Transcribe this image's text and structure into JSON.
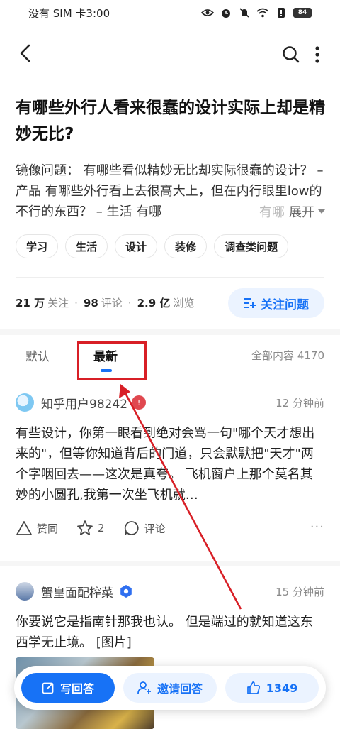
{
  "status_bar": {
    "carrier_time": "没有 SIM 卡3:00",
    "battery": "84"
  },
  "question": {
    "title": "有哪些外行人看来很蠢的设计实际上却是精妙无比?",
    "description": "镜像问题：  有哪些看似精妙无比却实际很蠢的设计？ – 产品  有哪些外行看上去很高大上，但在内行眼里low的不行的东西？ – 生活  有哪",
    "expand_fade": "有哪",
    "expand_label": "展开",
    "tags": [
      "学习",
      "生活",
      "设计",
      "装修",
      "调查类问题"
    ]
  },
  "stats": {
    "followers_num": "21 万",
    "followers_label": "关注",
    "comments_num": "98",
    "comments_label": "评论",
    "views_num": "2.9 亿",
    "views_label": "浏览",
    "follow_button": "关注问题"
  },
  "tabs": {
    "default": "默认",
    "latest": "最新",
    "all_count": "全部内容 4170"
  },
  "answers": [
    {
      "user": "知乎用户98242",
      "time": "12 分钟前",
      "body": "有些设计，你第一眼看到绝对会骂一句\"哪个天才想出来的\"，但等你知道背后的门道，只会默默把\"天才\"两个字咽回去——这次是真夸。 飞机窗户上那个莫名其妙的小圆孔,我第一次坐飞机就…",
      "agree_label": "赞同",
      "star_count": "2",
      "comment_label": "评论",
      "more": "···"
    },
    {
      "user": "蟹皇面配榨菜",
      "time": "15 分钟前",
      "body": "你要说它是指南针那我也认。 但是端过的就知道这东西学无止境。 [图片]"
    }
  ],
  "bottom_bar": {
    "write": "写回答",
    "invite": "邀请回答",
    "likes": "1349"
  },
  "colors": {
    "accent": "#1772f6",
    "accent_bg": "#ebf3ff",
    "annotation_red": "#d81f26"
  }
}
